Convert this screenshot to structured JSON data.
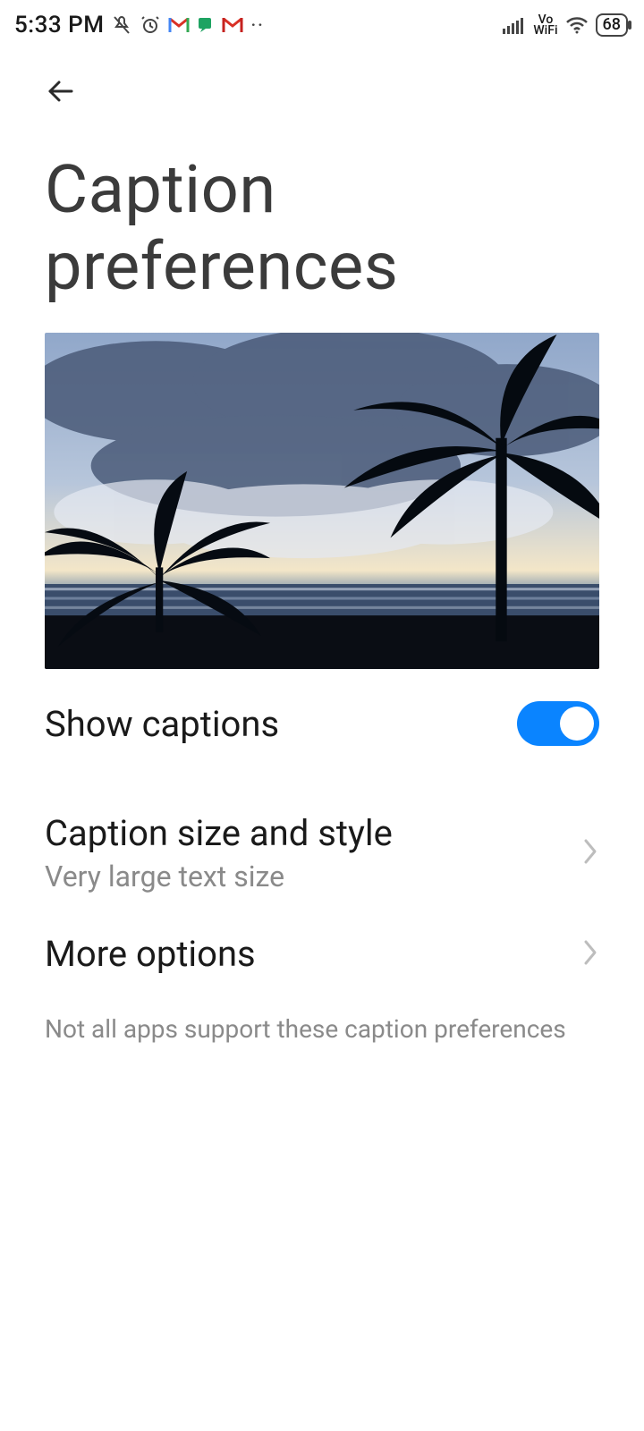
{
  "status": {
    "time": "5:33 PM",
    "battery": "68",
    "network_label": "Vo\nWiFi"
  },
  "header": {
    "title": "Caption preferences"
  },
  "settings": {
    "show_captions": {
      "label": "Show captions",
      "value": true
    },
    "size_style": {
      "label": "Caption size and style",
      "sub": "Very large text size"
    },
    "more": {
      "label": "More options"
    },
    "note": "Not all apps support these caption preferences"
  }
}
